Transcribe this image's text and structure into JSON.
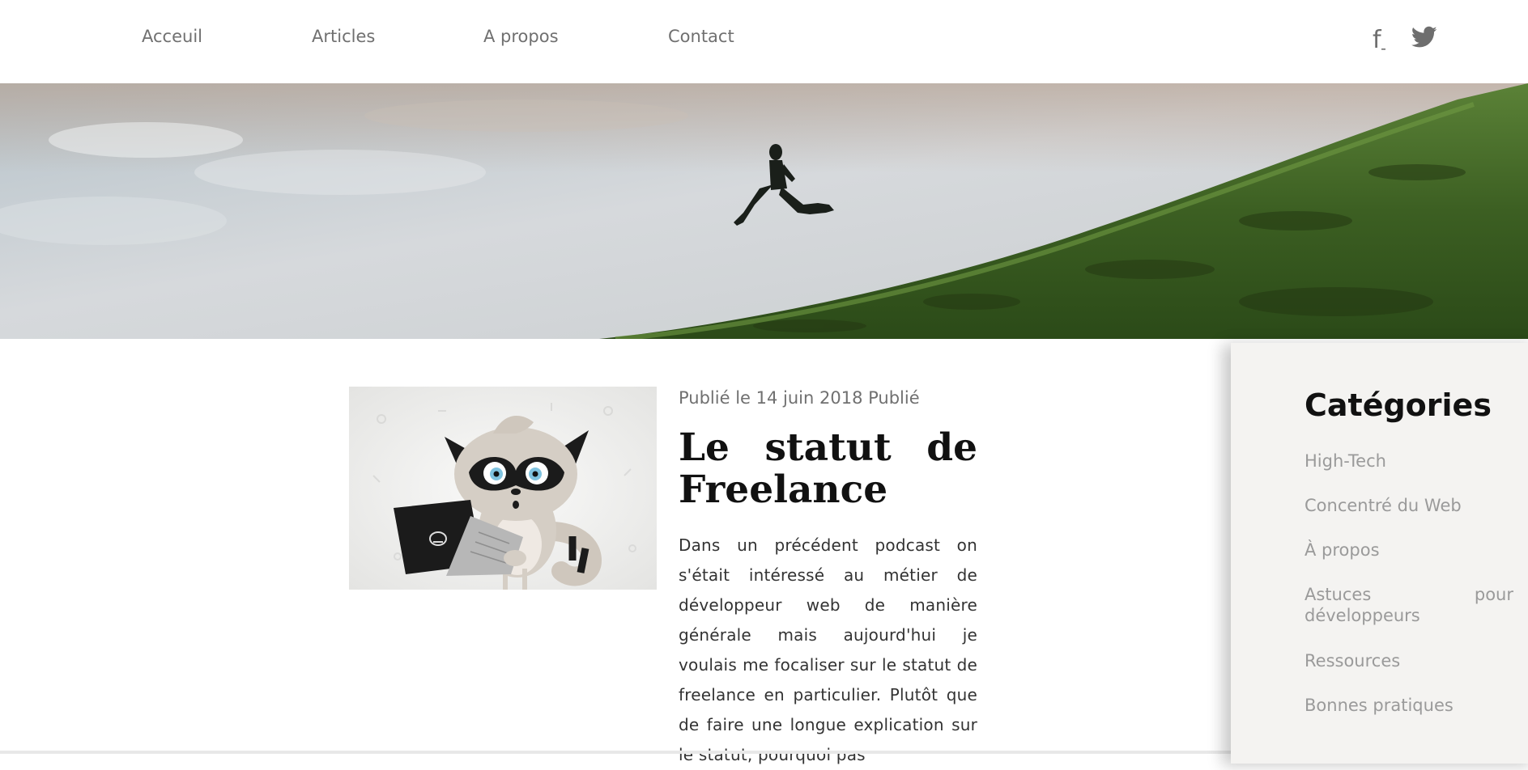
{
  "nav": {
    "items": [
      {
        "label": "Acceuil"
      },
      {
        "label": "Articles"
      },
      {
        "label": "A propos"
      },
      {
        "label": "Contact"
      }
    ],
    "social": [
      {
        "icon": "facebook-icon",
        "glyph": "f"
      },
      {
        "icon": "twitter-icon"
      }
    ]
  },
  "hero": {
    "description_colors": {
      "sky": "#c9d0d6",
      "grass": "#3f6424"
    }
  },
  "article": {
    "date": "Publié le 14 juin 2018 Publié",
    "title_word1": "Le",
    "title_word2": "statut",
    "title_word3": "de",
    "title_line2": "Freelance",
    "excerpt": "Dans un précédent podcast on s'était intéressé au métier de développeur web de manière générale mais aujourd'hui je voulais me focaliser sur le statut de freelance en particulier. Plutôt que de faire une longue explication sur le statut, pourquoi pas"
  },
  "sidebar": {
    "title": "Catégories",
    "categories": [
      {
        "label": "High-Tech"
      },
      {
        "label": "Concentré du Web"
      },
      {
        "label": "À propos"
      },
      {
        "label": "Astuces pour développeurs"
      },
      {
        "label": "Ressources"
      },
      {
        "label": "Bonnes pratiques"
      }
    ]
  },
  "colors": {
    "nav_text": "#707070",
    "category_text": "#9a9a9a",
    "sidebar_bg": "#f4f3f1"
  }
}
